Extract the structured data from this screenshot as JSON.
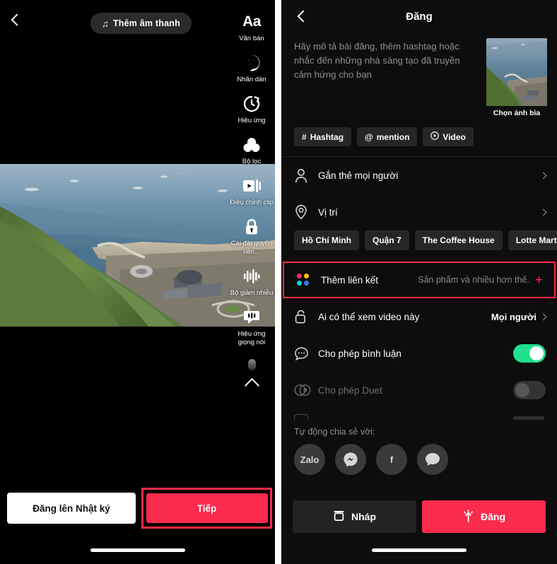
{
  "left_panel": {
    "back_icon": "chevron-left-icon",
    "sound_button": {
      "label": "Thêm âm thanh",
      "icon": "music-note-icon"
    },
    "tools": [
      {
        "label": "Văn bản",
        "icon": "text-aa-icon"
      },
      {
        "label": "Nhãn dán",
        "icon": "sticker-icon"
      },
      {
        "label": "Hiệu ứng",
        "icon": "effects-clock-icon"
      },
      {
        "label": "Bộ lọc",
        "icon": "filter-circles-icon"
      },
      {
        "label": "Điều chỉnh clip",
        "icon": "adjust-clip-icon"
      },
      {
        "label": "Cài đặt quyền riên...",
        "icon": "lock-icon"
      },
      {
        "label": "Bộ giảm nhiễu",
        "icon": "noise-reduction-icon"
      },
      {
        "label": "Hiệu ứng giọng nói",
        "icon": "voice-effects-icon"
      }
    ],
    "collapse_icon": "chevron-up-icon",
    "diary_button": "Đăng lên Nhật ký",
    "next_button": "Tiếp"
  },
  "right_panel": {
    "back_icon": "chevron-left-icon",
    "title": "Đăng",
    "description_placeholder": "Hãy mô tả bài đăng, thêm hashtag hoặc nhắc đến những nhà sáng tạo đã truyền cảm hứng cho bạn",
    "cover": {
      "label": "Chọn ảnh bìa"
    },
    "chips": [
      {
        "label": "Hashtag",
        "glyph": "#",
        "icon": "hashtag-icon"
      },
      {
        "label": "mention",
        "glyph": "@",
        "icon": "mention-icon"
      },
      {
        "label": "Video",
        "glyph": "▶",
        "icon": "video-play-icon"
      }
    ],
    "rows": {
      "tag_people": {
        "label": "Gắn thẻ mọi người",
        "icon": "person-icon"
      },
      "location": {
        "label": "Vị trí",
        "icon": "location-pin-icon"
      },
      "add_link": {
        "label": "Thêm liên kết",
        "hint": "Sản phẩm và nhiều hơn thế.",
        "icon": "four-dots-icon",
        "action_icon": "plus-icon",
        "highlight_color": "#ff2b43",
        "dot_colors": [
          "#ff2d6f",
          "#ffc300",
          "#00d6e0",
          "#2f7dfa"
        ]
      },
      "visibility": {
        "label": "Ai có thể xem video này",
        "value": "Mọi người",
        "icon": "unlock-icon"
      },
      "comments": {
        "label": "Cho phép bình luận",
        "icon": "comment-bubble-icon",
        "state": "on"
      },
      "duet": {
        "label": "Cho phép Duet",
        "icon": "duet-icon",
        "state": "off"
      }
    },
    "location_chips": [
      "Hồ Chí Minh",
      "Quận 7",
      "The Coffee House",
      "Lotte Mart District"
    ],
    "share": {
      "title": "Tự động chia sẻ với:",
      "items": [
        {
          "label": "Zalo",
          "icon": "zalo-icon"
        },
        {
          "label": "",
          "icon": "messenger-icon"
        },
        {
          "label": "f",
          "icon": "facebook-icon"
        },
        {
          "label": "",
          "icon": "sms-bubble-icon"
        }
      ]
    },
    "draft_button": {
      "label": "Nháp",
      "icon": "draft-box-icon"
    },
    "post_button": {
      "label": "Đăng",
      "icon": "post-sparkle-icon"
    }
  },
  "colors": {
    "accent_red": "#fa2b4d",
    "highlight_red": "#ff2b43",
    "toggle_green": "#20e08f",
    "panel_bg": "#0d0d0d"
  }
}
